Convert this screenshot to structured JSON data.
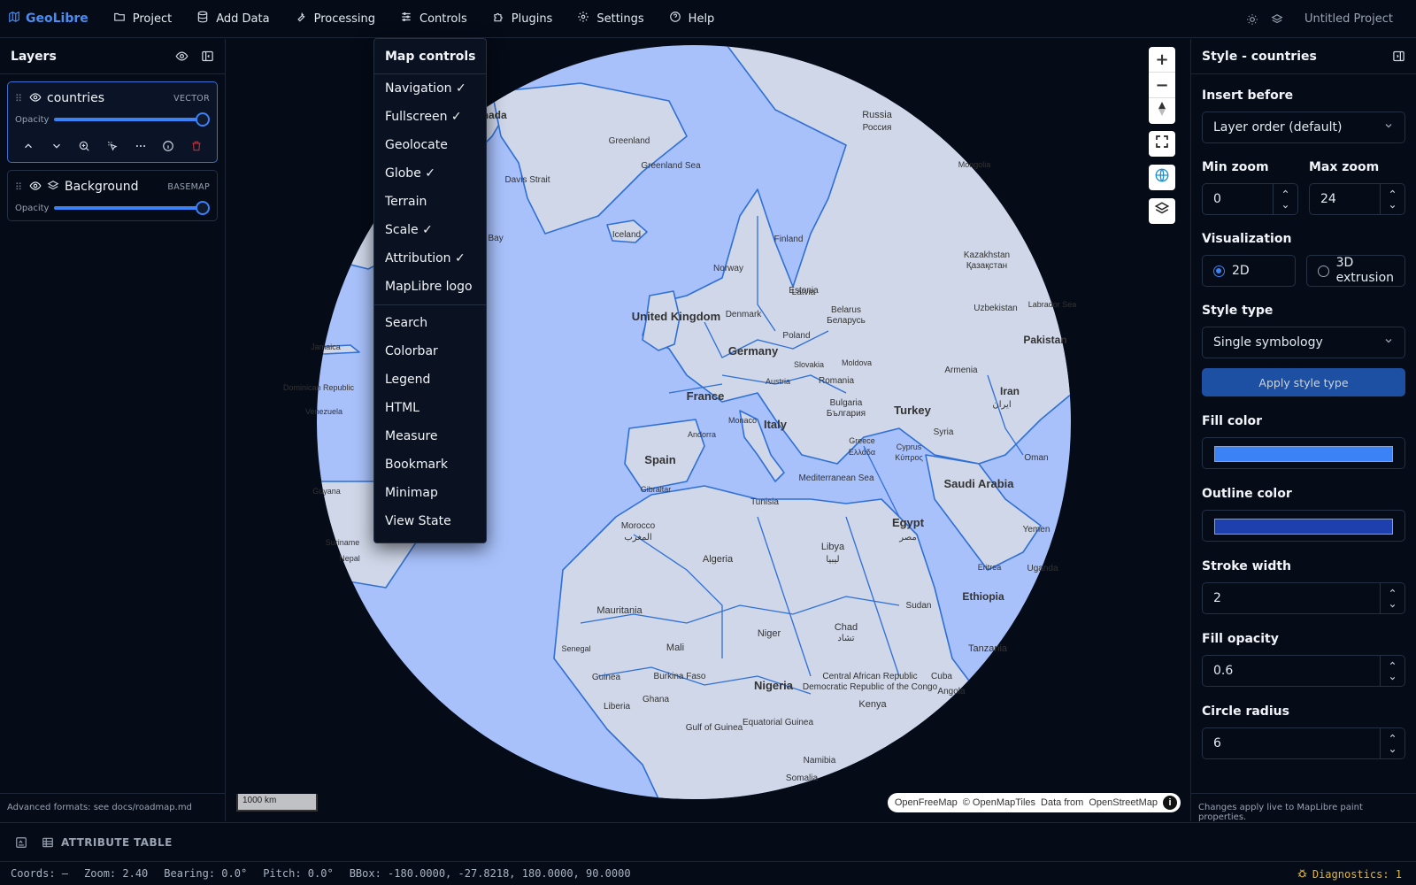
{
  "app": {
    "name": "GeoLibre",
    "project": "Untitled Project"
  },
  "menu": [
    {
      "label": "Project",
      "icon": "folder-icon"
    },
    {
      "label": "Add Data",
      "icon": "database-icon"
    },
    {
      "label": "Processing",
      "icon": "wrench-icon"
    },
    {
      "label": "Controls",
      "icon": "sliders-icon"
    },
    {
      "label": "Plugins",
      "icon": "puzzle-icon"
    },
    {
      "label": "Settings",
      "icon": "gear-icon"
    },
    {
      "label": "Help",
      "icon": "help-circle-icon"
    }
  ],
  "layers_panel": {
    "title": "Layers",
    "opacity_label": "Opacity",
    "layers": [
      {
        "name": "countries",
        "type": "VECTOR",
        "opacity": 1.0,
        "selected": true
      },
      {
        "name": "Background",
        "type": "BASEMAP",
        "opacity": 1.0,
        "selected": false
      }
    ],
    "footer": "Advanced formats: see docs/roadmap.md"
  },
  "controls_dropdown": {
    "title": "Map controls",
    "items": [
      "Navigation ✓",
      "Fullscreen ✓",
      "Geolocate",
      "Globe ✓",
      "Terrain",
      "Scale ✓",
      "Attribution ✓",
      "MapLibre logo"
    ],
    "items2": [
      "Search",
      "Colorbar",
      "Legend",
      "HTML",
      "Measure",
      "Bookmark",
      "Minimap",
      "View State"
    ]
  },
  "map": {
    "ocean_color": "#a8c1fb",
    "land_color": "#cfd7e8",
    "border_color": "#2f6fd6",
    "scale_label": "1000 km",
    "attribution": {
      "a": "OpenFreeMap",
      "b": "© OpenMapTiles",
      "c": "Data from",
      "d": "OpenStreetMap"
    },
    "labels": [
      {
        "t": "Canada"
      },
      {
        "t": "Greenland"
      },
      {
        "t": "Greenland Sea"
      },
      {
        "t": "Davis Strait"
      },
      {
        "t": "Iceland"
      },
      {
        "t": "Russia"
      },
      {
        "t": "Россия"
      },
      {
        "t": "Finland"
      },
      {
        "t": "Norway"
      },
      {
        "t": "Estonia"
      },
      {
        "t": "Latvia"
      },
      {
        "t": "Denmark"
      },
      {
        "t": "United Kingdom"
      },
      {
        "t": "Belarus"
      },
      {
        "t": "Беларусь"
      },
      {
        "t": "Poland"
      },
      {
        "t": "Germany"
      },
      {
        "t": "Slovakia"
      },
      {
        "t": "Moldova"
      },
      {
        "t": "Austria"
      },
      {
        "t": "Romania"
      },
      {
        "t": "France"
      },
      {
        "t": "Bulgaria"
      },
      {
        "t": "България"
      },
      {
        "t": "Monaco"
      },
      {
        "t": "Italy"
      },
      {
        "t": "Andorra"
      },
      {
        "t": "Spain"
      },
      {
        "t": "Turkey"
      },
      {
        "t": "Greece"
      },
      {
        "t": "Ελλάδα"
      },
      {
        "t": "Cyprus"
      },
      {
        "t": "Κύπρος"
      },
      {
        "t": "Syria"
      },
      {
        "t": "Mediterranean Sea"
      },
      {
        "t": "Tunisia"
      },
      {
        "t": "Gibraltar"
      },
      {
        "t": "Morocco"
      },
      {
        "t": "المغرب"
      },
      {
        "t": "Algeria"
      },
      {
        "t": "Libya"
      },
      {
        "t": "ليبيا"
      },
      {
        "t": "Egypt"
      },
      {
        "t": "مصر"
      },
      {
        "t": "Saudi Arabia"
      },
      {
        "t": "Iran"
      },
      {
        "t": "ایران"
      },
      {
        "t": "Pakistan"
      },
      {
        "t": "Kazakhstan"
      },
      {
        "t": "Қазақстан"
      },
      {
        "t": "Uzbekistan"
      },
      {
        "t": "Mongolia"
      },
      {
        "t": "Armenia"
      },
      {
        "t": "Oman"
      },
      {
        "t": "Yemen"
      },
      {
        "t": "Eritrea"
      },
      {
        "t": "Ethiopia"
      },
      {
        "t": "Sudan"
      },
      {
        "t": "Chad"
      },
      {
        "t": "تشاد"
      },
      {
        "t": "Niger"
      },
      {
        "t": "Mali"
      },
      {
        "t": "Mauritania"
      },
      {
        "t": "Senegal"
      },
      {
        "t": "Guinea"
      },
      {
        "t": "Burkina Faso"
      },
      {
        "t": "Nigeria"
      },
      {
        "t": "Ghana"
      },
      {
        "t": "Liberia"
      },
      {
        "t": "Gulf of Guinea"
      },
      {
        "t": "Equatorial Guinea"
      },
      {
        "t": "Central African Republic"
      },
      {
        "t": "Democratic Republic of the Congo"
      },
      {
        "t": "Kenya"
      },
      {
        "t": "Tanzania"
      },
      {
        "t": "Angola"
      },
      {
        "t": "Namibia"
      },
      {
        "t": "Somalia"
      },
      {
        "t": "Uganda"
      },
      {
        "t": "Cuba"
      },
      {
        "t": "Jamaica"
      },
      {
        "t": "Dominican Republic"
      },
      {
        "t": "Venezuela"
      },
      {
        "t": "Guyana"
      },
      {
        "t": "Suriname"
      },
      {
        "t": "Nepal"
      },
      {
        "t": "Labrador Sea"
      },
      {
        "t": "Baffin Bay"
      }
    ]
  },
  "style_panel": {
    "title": "Style - countries",
    "insert_before_label": "Insert before",
    "insert_before_value": "Layer order (default)",
    "min_zoom_label": "Min zoom",
    "min_zoom": "0",
    "max_zoom_label": "Max zoom",
    "max_zoom": "24",
    "visualization_label": "Visualization",
    "viz_2d": "2D",
    "viz_3d": "3D extrusion",
    "style_type_label": "Style type",
    "style_type_value": "Single symbology",
    "apply_label": "Apply style type",
    "fill_color_label": "Fill color",
    "fill_color": "#3b82f6",
    "outline_color_label": "Outline color",
    "outline_color": "#1e40af",
    "stroke_width_label": "Stroke width",
    "stroke_width": "2",
    "fill_opacity_label": "Fill opacity",
    "fill_opacity": "0.6",
    "circle_radius_label": "Circle radius",
    "circle_radius": "6",
    "footer": "Changes apply live to MapLibre paint properties."
  },
  "attribute_table": {
    "label": "ATTRIBUTE TABLE"
  },
  "status": {
    "coords": "Coords: —",
    "zoom": "Zoom: 2.40",
    "bearing": "Bearing: 0.0°",
    "pitch": "Pitch: 0.0°",
    "bbox": "BBox: -180.0000, -27.8218, 180.0000, 90.0000",
    "diagnostics": "Diagnostics: 1"
  }
}
